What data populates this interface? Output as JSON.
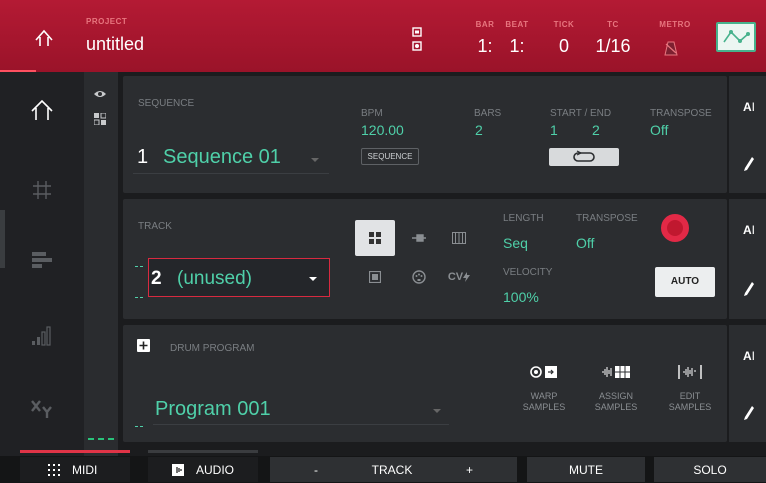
{
  "header": {
    "project_label": "PROJECT",
    "project_name": "untitled",
    "bar_label": "BAR",
    "bar_value": "1:",
    "beat_label": "BEAT",
    "beat_value": "1:",
    "tick_label": "TICK",
    "tick_value": "0",
    "tc_label": "TC",
    "tc_value": "1/16",
    "metro_label": "METRO",
    "icons": [
      "home-icon",
      "song-mode-icon",
      "metronome-icon",
      "automation-icon"
    ],
    "colors": {
      "header_red": "#b41a34",
      "accent_teal": "#4fd0a9",
      "record_red": "#e22946"
    }
  },
  "nav": {
    "items": [
      {
        "name": "home",
        "icon": "home-icon"
      },
      {
        "name": "step-sequencer",
        "icon": "grid-icon"
      },
      {
        "name": "track-view",
        "icon": "bars-icon"
      },
      {
        "name": "mixer",
        "icon": "level-icon"
      },
      {
        "name": "xyfx",
        "icon": "xy-icon"
      }
    ]
  },
  "sequence": {
    "label": "SEQUENCE",
    "number": "1",
    "name": "Sequence 01",
    "bpm_label": "BPM",
    "bpm": "120.00",
    "bars_label": "BARS",
    "bars": "2",
    "start_end_label": "START / END",
    "start": "1",
    "end": "2",
    "transpose_label": "TRANSPOSE",
    "transpose": "Off",
    "sequence_button": "SEQUENCE"
  },
  "track": {
    "label": "TRACK",
    "number": "2",
    "name": "(unused)",
    "length_label": "LENGTH",
    "length": "Seq",
    "transpose_label": "TRANSPOSE",
    "transpose": "Off",
    "velocity_label": "VELOCITY",
    "velocity": "100%",
    "type_buttons": [
      "drum",
      "plugin",
      "keygroup",
      "clip",
      "midi",
      "cv"
    ],
    "cv_label": "CV",
    "auto_button": "AUTO"
  },
  "program": {
    "label": "DRUM PROGRAM",
    "name": "Program 001",
    "actions": [
      {
        "line1": "WARP",
        "line2": "SAMPLES"
      },
      {
        "line1": "ASSIGN",
        "line2": "SAMPLES"
      },
      {
        "line1": "EDIT",
        "line2": "SAMPLES"
      }
    ]
  },
  "side": {
    "at_label": "A"
  },
  "bottom": {
    "midi": "MIDI",
    "audio": "AUDIO",
    "minus": "-",
    "track": "TRACK",
    "plus": "+",
    "mute": "MUTE",
    "solo": "SOLO"
  }
}
